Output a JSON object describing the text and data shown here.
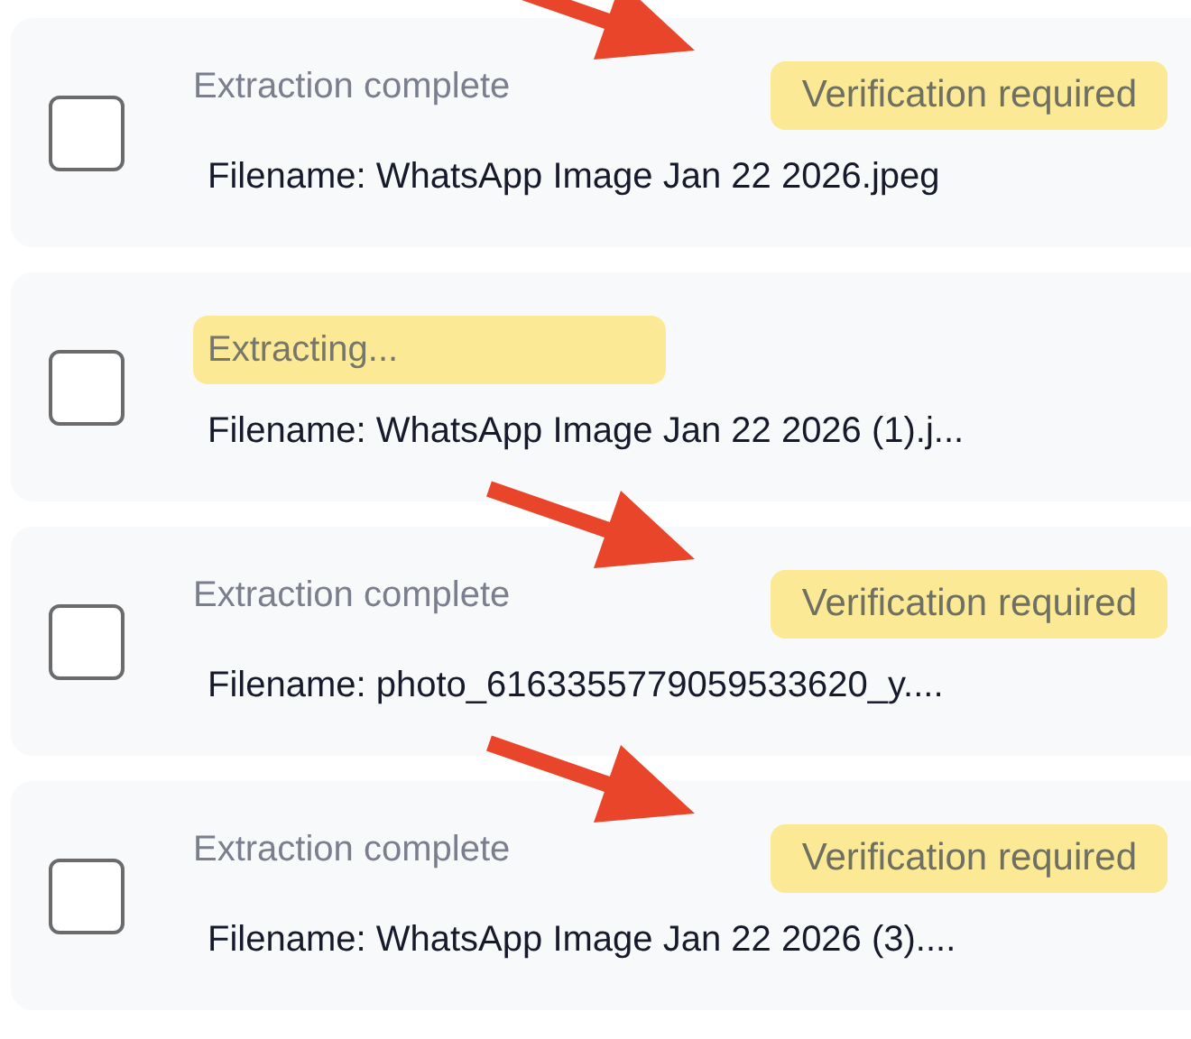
{
  "files": [
    {
      "kind": "complete",
      "status": "Extraction complete",
      "badge": "Verification required",
      "arrow": true,
      "checked": false,
      "filename": "Filename: WhatsApp Image Jan 22 2026.jpeg"
    },
    {
      "kind": "extracting",
      "status": "Extracting...",
      "arrow": false,
      "checked": false,
      "filename": "Filename: WhatsApp Image Jan 22 2026 (1).j..."
    },
    {
      "kind": "complete",
      "status": "Extraction complete",
      "badge": "Verification required",
      "arrow": true,
      "checked": false,
      "filename": "Filename: photo_6163355779059533620_y...."
    },
    {
      "kind": "complete",
      "status": "Extraction complete",
      "badge": "Verification required",
      "arrow": true,
      "checked": false,
      "filename": "Filename: WhatsApp Image Jan 22 2026 (3)...."
    }
  ]
}
